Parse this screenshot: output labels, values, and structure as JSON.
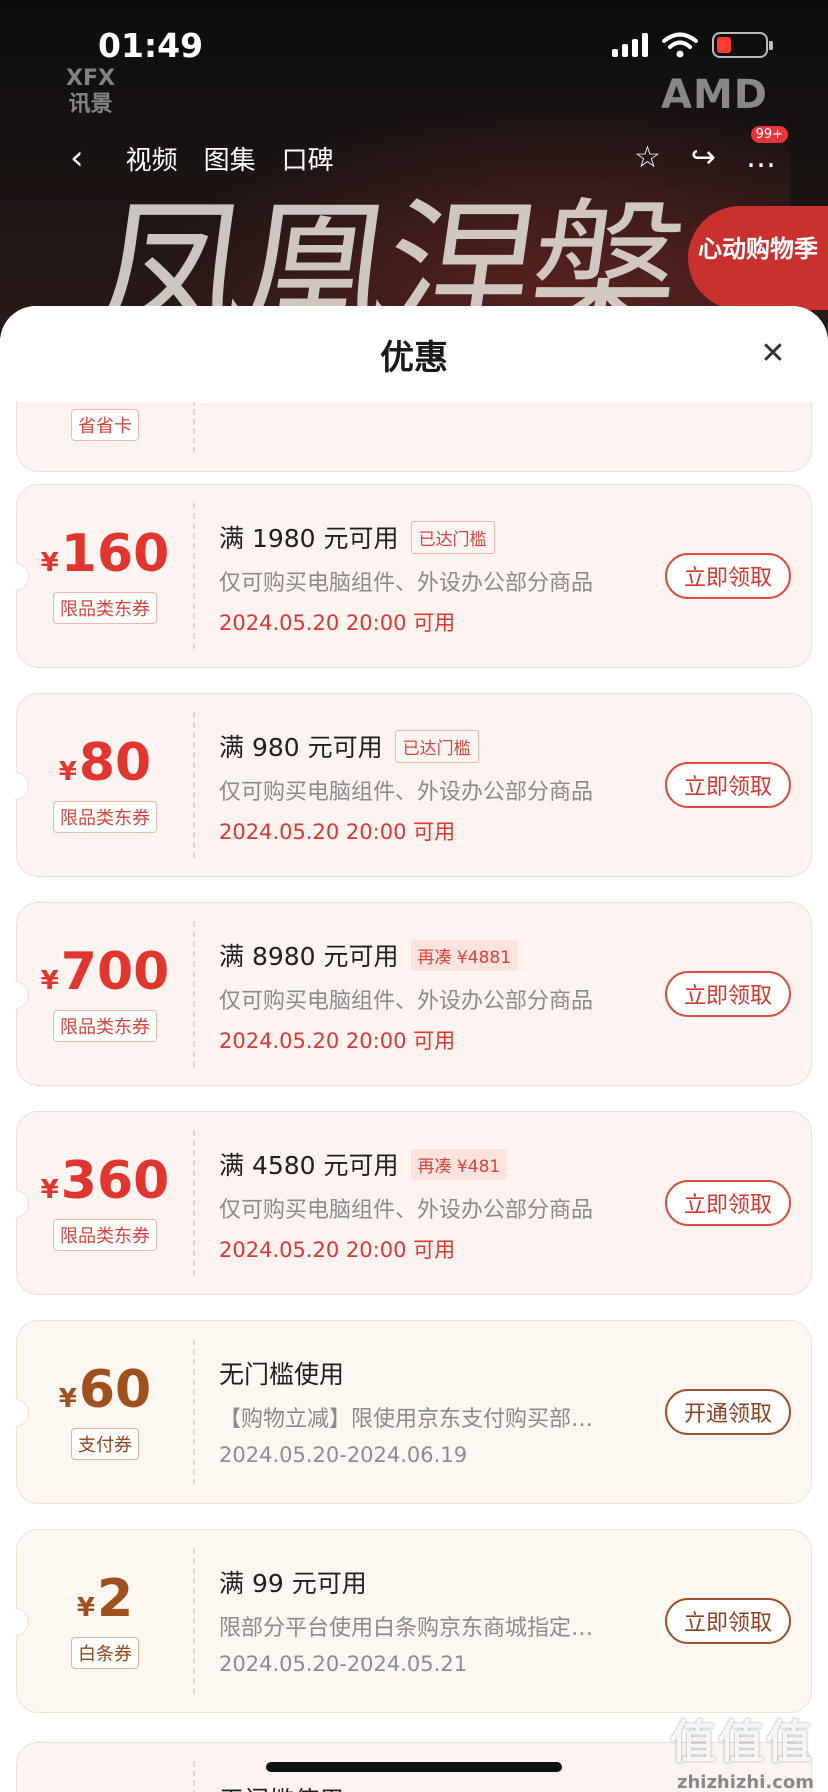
{
  "status": {
    "time": "01:49"
  },
  "banner": {
    "brand_left": "XFX",
    "brand_left_cn": "讯景",
    "brand_right": "AMD",
    "art_text": "凤凰涅槃",
    "promo": "心动购物季",
    "badge": "99+"
  },
  "nav": {
    "tabs": [
      "视频",
      "图集",
      "口碑"
    ]
  },
  "sheet": {
    "title": "优惠",
    "partial_tag": "省省卡"
  },
  "coupons": [
    {
      "yen": "¥",
      "amount": "160",
      "tag": "限品类东券",
      "condition": "满 1980 元可用",
      "pill": "已达门槛",
      "pill_type": "reached",
      "desc": "仅可购买电脑组件、外设办公部分商品",
      "date": "2024.05.20 20:00 可用",
      "button": "立即领取",
      "style": "red"
    },
    {
      "yen": "¥",
      "amount": "80",
      "tag": "限品类东券",
      "condition": "满 980 元可用",
      "pill": "已达门槛",
      "pill_type": "reached",
      "desc": "仅可购买电脑组件、外设办公部分商品",
      "date": "2024.05.20 20:00 可用",
      "button": "立即领取",
      "style": "red"
    },
    {
      "yen": "¥",
      "amount": "700",
      "tag": "限品类东券",
      "condition": "满 8980 元可用",
      "pill": "再凑 ¥4881",
      "pill_type": "more",
      "desc": "仅可购买电脑组件、外设办公部分商品",
      "date": "2024.05.20 20:00 可用",
      "button": "立即领取",
      "style": "red"
    },
    {
      "yen": "¥",
      "amount": "360",
      "tag": "限品类东券",
      "condition": "满 4580 元可用",
      "pill": "再凑 ¥481",
      "pill_type": "more",
      "desc": "仅可购买电脑组件、外设办公部分商品",
      "date": "2024.05.20 20:00 可用",
      "button": "立即领取",
      "style": "red"
    },
    {
      "yen": "¥",
      "amount": "60",
      "tag": "支付券",
      "condition": "无门槛使用",
      "pill": "",
      "pill_type": "",
      "desc": "【购物立减】限使用京东支付购买部…",
      "date": "2024.05.20-2024.06.19",
      "button": "开通领取",
      "style": "pay"
    },
    {
      "yen": "¥",
      "amount": "2",
      "tag": "白条券",
      "condition": "满 99 元可用",
      "pill": "",
      "pill_type": "",
      "desc": "限部分平台使用白条购京东商城指定…",
      "date": "2024.05.20-2024.05.21",
      "button": "立即领取",
      "style": "pay"
    }
  ],
  "partial_bottom": "无门槛使用",
  "watermark": {
    "big": "值值值",
    "small": "zhizhizhi.com"
  }
}
